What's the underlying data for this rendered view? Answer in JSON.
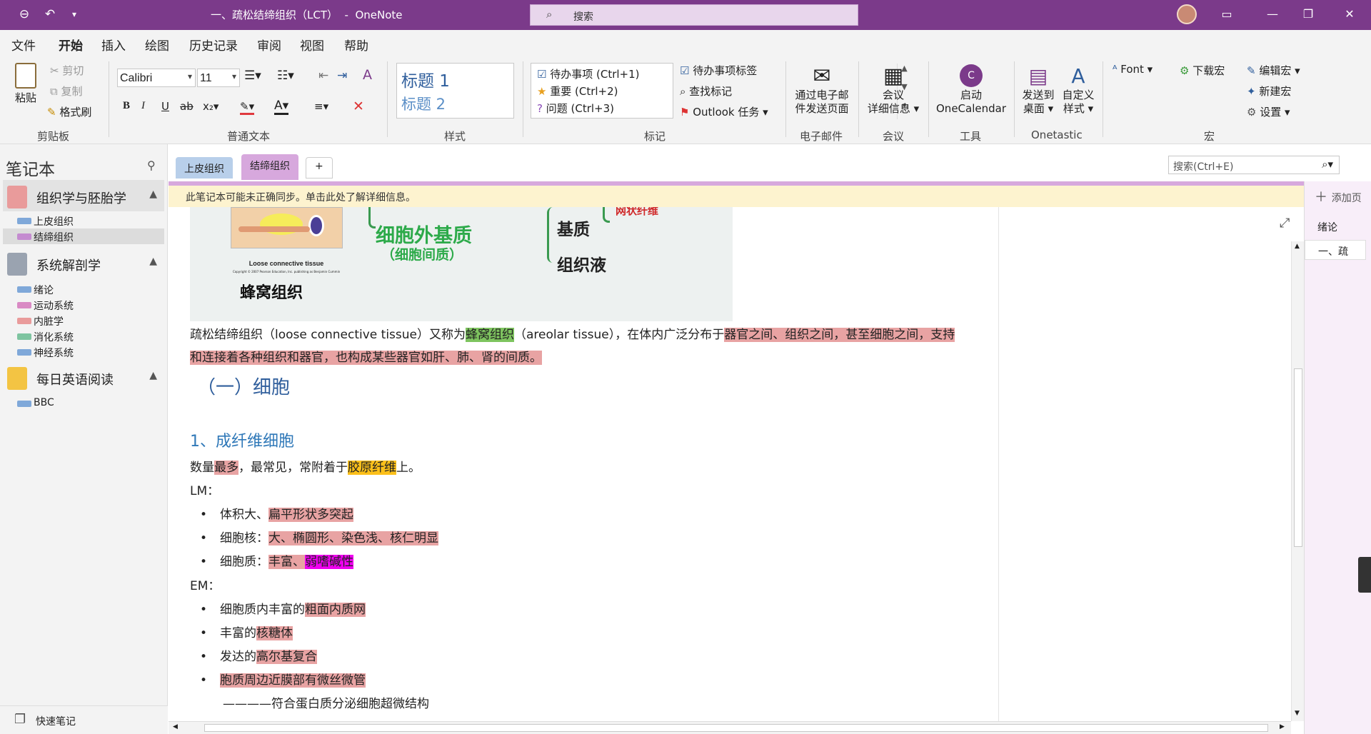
{
  "titlebar": {
    "title": "一、疏松结缔组织（LCT）  -  OneNote",
    "search_placeholder": "搜索"
  },
  "menu": [
    "文件",
    "开始",
    "插入",
    "绘图",
    "历史记录",
    "审阅",
    "视图",
    "帮助"
  ],
  "ribbon": {
    "clipboard": {
      "paste": "粘贴",
      "cut": "剪切",
      "copy": "复制",
      "format_painter": "格式刷",
      "group": "剪贴板"
    },
    "font": {
      "name": "Calibri",
      "size": "11",
      "group": "普通文本"
    },
    "styles": {
      "h1": "标题 1",
      "h2": "标题 2",
      "group": "样式"
    },
    "tags": {
      "todo": "待办事项 (Ctrl+1)",
      "important": "重要 (Ctrl+2)",
      "question": "问题 (Ctrl+3)",
      "todo_tag": "待办事项标签",
      "find_tags": "查找标记",
      "outlook": "Outlook 任务",
      "group": "标记"
    },
    "email": {
      "line1": "通过电子邮",
      "line2": "件发送页面",
      "group": "电子邮件"
    },
    "meeting": {
      "line1": "会议",
      "line2": "详细信息",
      "group": "会议"
    },
    "tools": {
      "line1": "启动",
      "line2": "OneCalendar",
      "group": "工具"
    },
    "onetastic": {
      "send1": "发送到",
      "send2": "桌面",
      "custom1": "自定义",
      "custom2": "样式",
      "group": "Onetastic"
    },
    "macro": {
      "font": "Font",
      "download": "下载宏",
      "edit": "编辑宏",
      "new": "新建宏",
      "settings": "设置",
      "group": "宏"
    }
  },
  "sidebar": {
    "title": "笔记本",
    "notebooks": [
      {
        "name": "组织学与胚胎学",
        "color": "#e99b9b",
        "sections": [
          {
            "label": "上皮组织",
            "color": "#7fa8d9"
          },
          {
            "label": "结缔组织",
            "color": "#c48bd0"
          }
        ]
      },
      {
        "name": "系统解剖学",
        "color": "#9aa3b0",
        "sections": [
          {
            "label": "绪论",
            "color": "#7fa8d9"
          },
          {
            "label": "运动系统",
            "color": "#d98ac4"
          },
          {
            "label": "内脏学",
            "color": "#e99b9b"
          },
          {
            "label": "消化系统",
            "color": "#7ec4a0"
          },
          {
            "label": "神经系统",
            "color": "#7fa8d9"
          }
        ]
      },
      {
        "name": "每日英语阅读",
        "color": "#f3c443",
        "sections": [
          {
            "label": "BBC",
            "color": "#7fa8d9"
          }
        ]
      }
    ],
    "quick_notes": "快速笔记"
  },
  "tabs": {
    "sections": [
      "上皮组织",
      "结缔组织"
    ],
    "add": "+",
    "page_search": "搜索(Ctrl+E)"
  },
  "notify": "此笔记本可能未正确同步。单击此处了解详细信息。",
  "pages": {
    "add": "添加页",
    "items": [
      "绪论",
      "一、疏"
    ]
  },
  "figure": {
    "caption": "Loose connective tissue",
    "copyright": "Copyright © 2007 Pearson Education, Inc. publishing as Benjamin Cummings.",
    "label": "蜂窝组织",
    "ecm": "细胞外基质",
    "ecm_sub": "（细胞间质）",
    "matrix": "基质",
    "fluid": "组织液",
    "fiber": "网状纤维"
  },
  "content": {
    "p1a": "疏松结缔组织（loose connective tissue）又称为",
    "p1b": "蜂窝组织",
    "p1c": "（areolar tissue），在体内广泛分布于",
    "p1d": "器官之间、组织之间，甚至细胞之间，支持",
    "p2": "和连接着各种组织和器官，也构成某些器官如肝、肺、肾的间质。",
    "h1": "（一）细胞",
    "h2": "1、成纤维细胞",
    "q1": "数量",
    "q2": "最多",
    "q3": "，最常见，常附着于",
    "q4": "胶原纤维",
    "q5": "上。",
    "lm": "LM：",
    "b1a": "体积大、",
    "b1b": "扁平形状多突起",
    "b2a": "细胞核：",
    "b2b": "大、椭圆形、染色浅、核仁明显",
    "b3a": "细胞质：",
    "b3b": "丰富",
    "b3c": "、",
    "b3d": "弱嗜碱性",
    "em": "EM：",
    "b4a": "细胞质内丰富的",
    "b4b": "粗面内质网",
    "b5a": "丰富的",
    "b5b": "核糖体",
    "b6a": "发达的",
    "b6b": "高尔基复合",
    "b7": "胞质周边近膜部有微丝微管",
    "last": "————符合蛋白质分泌细胞超微结构"
  }
}
